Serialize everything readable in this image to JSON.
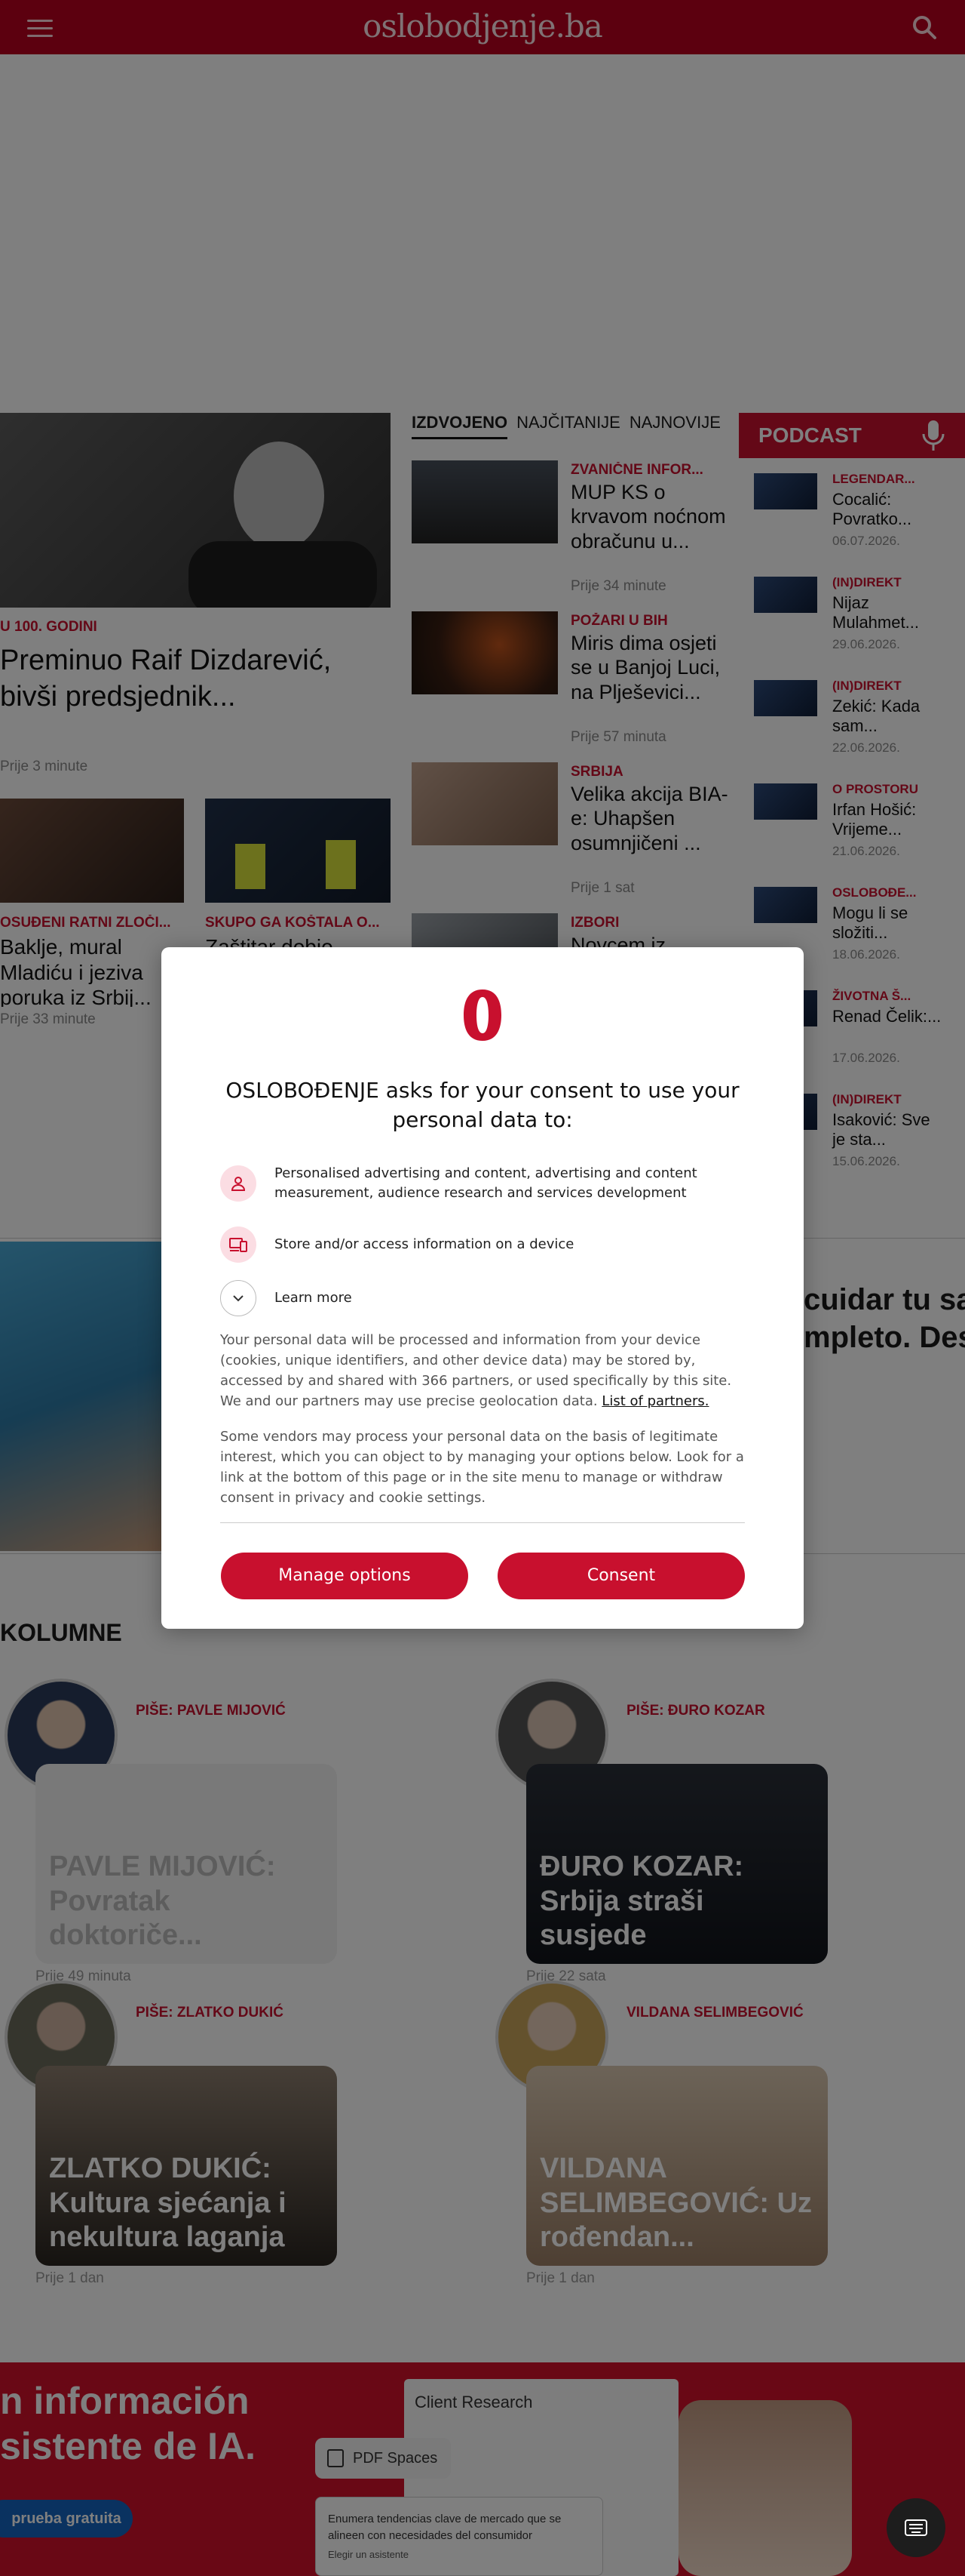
{
  "header": {
    "logo": "oslobodjenje.ba",
    "menu_icon": "hamburger-menu-icon",
    "search_icon": "search-icon",
    "bg_color": "#b8001f"
  },
  "lead": {
    "kicker": "U 100. GODINI",
    "title": "Preminuo Raif Dizdarević, bivši predsjednik...",
    "time": "Prije 3 minute"
  },
  "secondary": [
    {
      "kicker": "OSUĐENI RATNI ZLOČI...",
      "title": "Baklje, mural Mladiću i jeziva poruka iz Srbij...",
      "time": "Prije 33 minute"
    },
    {
      "kicker": "SKUPO GA KOŠTALA O...",
      "title": "Zaštitar dobio...",
      "time": ""
    }
  ],
  "tabs": {
    "items": [
      "IZDVOJENO",
      "NAJČITANIJE",
      "NAJNOVIJE"
    ],
    "active": "IZDVOJENO"
  },
  "featured": [
    {
      "kicker": "ZVANIČNE INFOR...",
      "title": "MUP KS o krvavom noćnom obračunu u...",
      "time": "Prije 34 minute"
    },
    {
      "kicker": "POŽARI U BIH",
      "title": "Miris dima osjeti se u Banjoj Luci, na Plješevici...",
      "time": "Prije 57 minuta"
    },
    {
      "kicker": "SRBIJA",
      "title": "Velika akcija BIA-e: Uhapšen osumnjičeni ...",
      "time": "Prije 1 sat"
    },
    {
      "kicker": "IZBORI",
      "title": "Novcem iz...",
      "time": ""
    }
  ],
  "podcast": {
    "title": "PODCAST",
    "icon": "microphone-icon",
    "items": [
      {
        "kicker": "LEGENDAR...",
        "title": "Cocalić: Povratko...",
        "date": "06.07.2026."
      },
      {
        "kicker": "(IN)DIREKT",
        "title": "Nijaz Mulahmet...",
        "date": "29.06.2026."
      },
      {
        "kicker": "(IN)DIREKT",
        "title": "Zekić: Kada sam...",
        "date": "22.06.2026."
      },
      {
        "kicker": "O PROSTORU",
        "title": "Irfan Hošić: Vrijeme...",
        "date": "21.06.2026."
      },
      {
        "kicker": "OSLOBOĐE...",
        "title": "Mogu li se složiti...",
        "date": "18.06.2026."
      },
      {
        "kicker": "ŽIVOTNA Š...",
        "title": "Renad Čelik:...",
        "date": "17.06.2026."
      },
      {
        "kicker": "(IN)DIREKT",
        "title": "Isaković: Sve je sta...",
        "date": "15.06.2026."
      }
    ]
  },
  "mid_ad": {
    "line1": "cuidar tu sal",
    "line2": "mpleto. Des"
  },
  "kolumne": {
    "title": "KOLUMNE",
    "items": [
      {
        "author": "PIŠE: PAVLE MIJOVIĆ",
        "title": "PAVLE MIJOVIĆ: Povratak doktoriče...",
        "time": "Prije 49 minuta"
      },
      {
        "author": "PIŠE: ĐURO KOZAR",
        "title": "ĐURO KOZAR: Srbija straši susjede",
        "time": "Prije 22 sata"
      },
      {
        "author": "PIŠE: ZLATKO DUKIĆ",
        "title": "ZLATKO DUKIĆ: Kultura sjećanja i nekultura laganja",
        "time": "Prije 1 dan"
      },
      {
        "author": "VILDANA SELIMBEGOVIĆ",
        "title": "VILDANA SELIMBEGOVIĆ: Uz rođendan...",
        "time": "Prije 1 dan"
      }
    ]
  },
  "bottom_ad": {
    "line1": "n información",
    "line2": "sistente de IA.",
    "cta": "prueba gratuita",
    "card_title": "Client Research",
    "chip": "PDF Spaces",
    "prompt": "Enumera tendencias clave de mercado que se alineen con necesidades del consumidor",
    "select": "Elegir un asistente"
  },
  "consent": {
    "title": "OSLOBOĐENJE asks for your consent to use your personal data to:",
    "purposes": [
      {
        "icon": "person-icon",
        "text": "Personalised advertising and content, advertising and content measurement, audience research and services development"
      },
      {
        "icon": "device-icon",
        "text": "Store and/or access information on a device"
      }
    ],
    "learn_more": "Learn more",
    "paragraph1": "Your personal data will be processed and information from your device (cookies, unique identifiers, and other device data) may be stored by, accessed by and shared with 366 partners, or used specifically by this site. We and our partners may use precise geolocation data.",
    "partners_link": "List of partners.",
    "paragraph2": "Some vendors may process your personal data on the basis of legitimate interest, which you can object to by managing your options below. Look for a link at the bottom of this page or in the site menu to manage or withdraw consent in privacy and cookie settings.",
    "manage_button": "Manage options",
    "consent_button": "Consent",
    "accent_color": "#c8102e"
  },
  "floating": {
    "icon": "keyboard-icon"
  }
}
